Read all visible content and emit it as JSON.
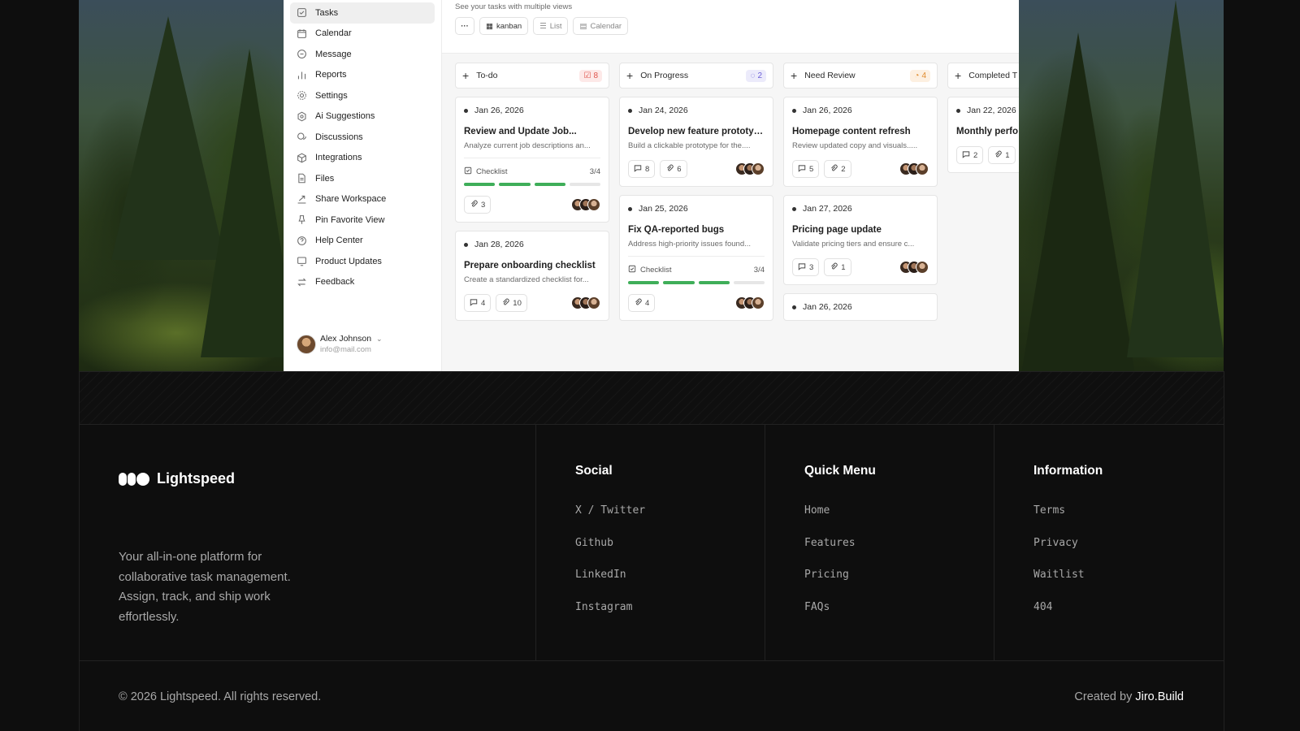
{
  "app": {
    "subtitle": "See your tasks with multiple views",
    "views": [
      {
        "label": "kanban"
      },
      {
        "label": "List"
      },
      {
        "label": "Calendar"
      }
    ],
    "more_label": "···",
    "sidebar": {
      "items": [
        {
          "label": "Tasks",
          "icon": "check-square-icon"
        },
        {
          "label": "Calendar",
          "icon": "calendar-icon"
        },
        {
          "label": "Message",
          "icon": "message-icon"
        },
        {
          "label": "Reports",
          "icon": "bar-chart-icon"
        },
        {
          "label": "Settings",
          "icon": "gear-icon"
        },
        {
          "label": "Ai Suggestions",
          "icon": "ai-icon"
        },
        {
          "label": "Discussions",
          "icon": "discussion-icon"
        },
        {
          "label": "Integrations",
          "icon": "cube-icon"
        },
        {
          "label": "Files",
          "icon": "file-icon"
        },
        {
          "label": "Share Workspace",
          "icon": "share-icon"
        },
        {
          "label": "Pin Favorite View",
          "icon": "pin-icon"
        },
        {
          "label": "Help Center",
          "icon": "help-icon"
        },
        {
          "label": "Product Updates",
          "icon": "monitor-icon"
        },
        {
          "label": "Feedback",
          "icon": "feedback-icon"
        }
      ]
    },
    "user": {
      "name": "Alex Johnson",
      "email": "info@mail.com"
    },
    "columns": [
      {
        "title": "To-do",
        "count": "8",
        "badge_color": "#e0534b",
        "badge_bg": "#fde9e8",
        "cards": [
          {
            "date": "Jan 26, 2026",
            "title": "Review and Update Job...",
            "desc": "Analyze current job descriptions an...",
            "checklist": {
              "label": "Checklist",
              "count": "3/4"
            },
            "comments": "",
            "attachments": "3"
          },
          {
            "date": "Jan 28, 2026",
            "title": "Prepare onboarding checklist",
            "desc": "Create a standardized checklist for...",
            "comments": "4",
            "attachments": "10"
          }
        ]
      },
      {
        "title": "On Progress",
        "count": "2",
        "badge_color": "#6b5fd6",
        "badge_bg": "#ecebfb",
        "cards": [
          {
            "date": "Jan 24, 2026",
            "title": "Develop new feature prototype",
            "desc": "Build a clickable prototype for the....",
            "comments": "8",
            "attachments": "6"
          },
          {
            "date": "Jan 25, 2026",
            "title": "Fix QA-reported bugs",
            "desc": "Address high-priority issues found...",
            "checklist": {
              "label": "Checklist",
              "count": "3/4"
            },
            "comments": "",
            "attachments": "4"
          }
        ]
      },
      {
        "title": "Need Review",
        "count": "4",
        "badge_color": "#e08a2b",
        "badge_bg": "#fdf0e1",
        "cards": [
          {
            "date": "Jan 26, 2026",
            "title": "Homepage content refresh",
            "desc": "Review updated copy and visuals.....",
            "comments": "5",
            "attachments": "2"
          },
          {
            "date": "Jan 27, 2026",
            "title": "Pricing page update",
            "desc": "Validate pricing tiers and ensure c...",
            "comments": "3",
            "attachments": "1"
          },
          {
            "date": "Jan 26, 2026"
          }
        ]
      },
      {
        "title": "Completed T",
        "cards": [
          {
            "date": "Jan 22, 2026",
            "title": "Monthly perfo",
            "comments": "2",
            "attachments": "1"
          }
        ]
      }
    ]
  },
  "footer": {
    "brand": "Lightspeed",
    "tagline": "Your all-in-one platform for collaborative task management. Assign, track, and ship work effortlessly.",
    "columns": [
      {
        "heading": "Social",
        "links": [
          "X / Twitter",
          "Github",
          "LinkedIn",
          "Instagram"
        ]
      },
      {
        "heading": "Quick Menu",
        "links": [
          "Home",
          "Features",
          "Pricing",
          "FAQs"
        ]
      },
      {
        "heading": "Information",
        "links": [
          "Terms",
          "Privacy",
          "Waitlist",
          "404"
        ]
      }
    ],
    "copyright": "© 2026 Lightspeed. All rights reserved.",
    "credit_prefix": "Created by",
    "credit_name": "Jiro.Build"
  }
}
